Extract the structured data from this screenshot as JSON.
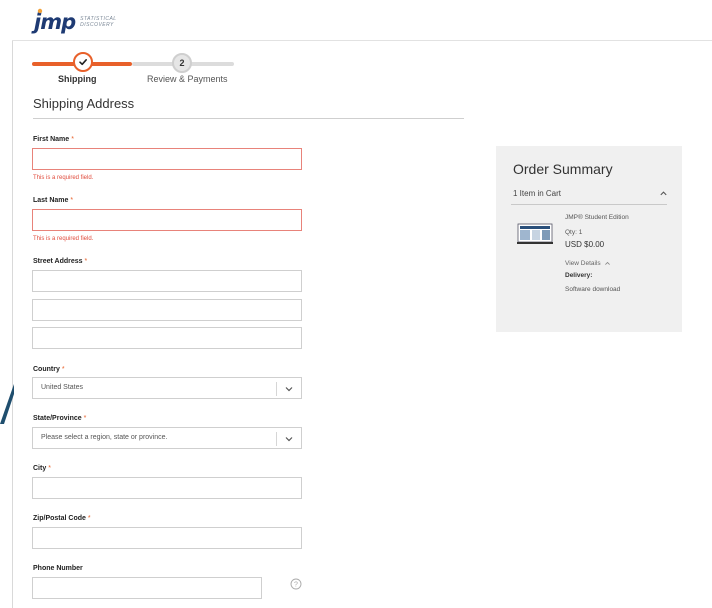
{
  "brand": {
    "logo_text": "jmp",
    "tagline_line1": "STATISTICAL",
    "tagline_line2": "DISCOVERY",
    "accent_color": "#e8602a",
    "logo_color": "#1e3a73"
  },
  "stepper": {
    "steps": [
      {
        "number": "1",
        "label": "Shipping",
        "state": "complete"
      },
      {
        "number": "2",
        "label": "Review & Payments",
        "state": "upcoming"
      }
    ]
  },
  "shipping": {
    "title": "Shipping Address",
    "required_marker": "*",
    "error_text": "This is a required field.",
    "first_name": {
      "label": "First Name",
      "value": ""
    },
    "last_name": {
      "label": "Last Name",
      "value": ""
    },
    "street": {
      "label": "Street Address",
      "line1": "",
      "line2": "",
      "line3": ""
    },
    "country": {
      "label": "Country",
      "value": "United States"
    },
    "state": {
      "label": "State/Province",
      "value": "Please select a region, state or province."
    },
    "city": {
      "label": "City",
      "value": ""
    },
    "zip": {
      "label": "Zip/Postal Code",
      "value": ""
    },
    "phone": {
      "label": "Phone Number",
      "value": ""
    }
  },
  "summary": {
    "title": "Order Summary",
    "items_count": "1 Item in Cart",
    "item": {
      "name": "JMP® Student Edition",
      "qty": "Qty: 1",
      "price": "USD $0.00",
      "view_details": "View Details",
      "delivery_label": "Delivery:",
      "delivery_value": "Software download"
    }
  },
  "icons": [
    "check-icon",
    "chevron-down-icon",
    "chevron-up-icon",
    "help-icon",
    "product-thumbnail"
  ]
}
